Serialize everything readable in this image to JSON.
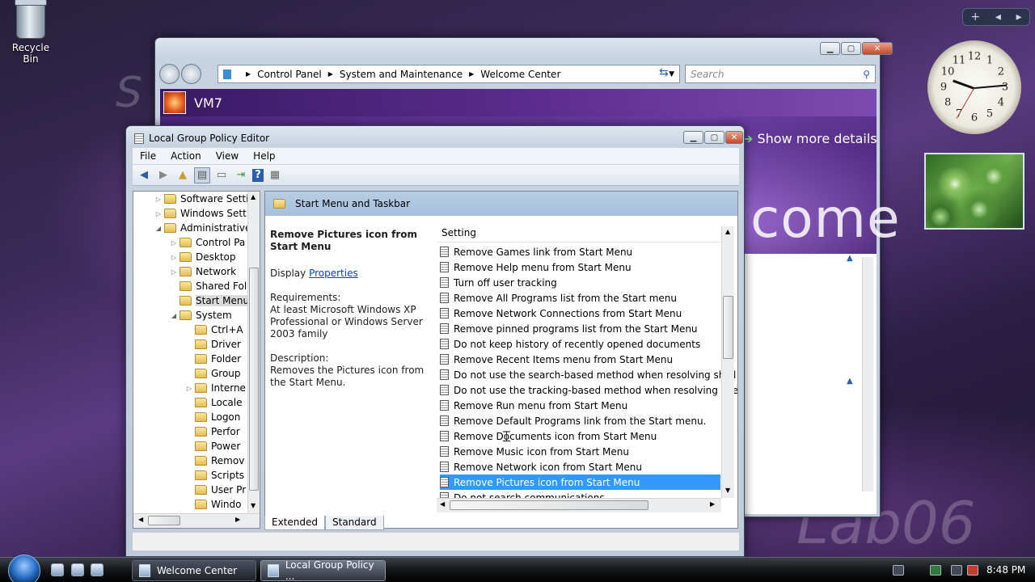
{
  "desktop": {
    "recycle_bin_label": "Recycle Bin",
    "bg_text_left": "S",
    "bg_text_right": "Lab06"
  },
  "sidebar": {
    "clock_numbers": [
      "12",
      "1",
      "2",
      "3",
      "4",
      "5",
      "6",
      "7",
      "8",
      "9",
      "10",
      "11"
    ]
  },
  "welcome_center": {
    "breadcrumb": [
      "Control Panel",
      "System and Maintenance",
      "Welcome Center"
    ],
    "search_placeholder": "Search",
    "computer_name": "VM7",
    "show_more_details": "Show more details",
    "welcome_text": "come"
  },
  "gpe": {
    "title": "Local Group Policy Editor",
    "menu": [
      "File",
      "Action",
      "View",
      "Help"
    ],
    "tree": [
      {
        "label": "Software Setti",
        "indent": 1,
        "toggle": "▷"
      },
      {
        "label": "Windows Sett",
        "indent": 1,
        "toggle": "▷"
      },
      {
        "label": "Administrative",
        "indent": 1,
        "toggle": "◢"
      },
      {
        "label": "Control Pa",
        "indent": 2,
        "toggle": "▷"
      },
      {
        "label": "Desktop",
        "indent": 2,
        "toggle": "▷"
      },
      {
        "label": "Network",
        "indent": 2,
        "toggle": "▷"
      },
      {
        "label": "Shared Fol",
        "indent": 2,
        "toggle": ""
      },
      {
        "label": "Start Menu",
        "indent": 2,
        "toggle": "",
        "selected": true
      },
      {
        "label": "System",
        "indent": 2,
        "toggle": "◢"
      },
      {
        "label": "Ctrl+A",
        "indent": 3,
        "toggle": ""
      },
      {
        "label": "Driver",
        "indent": 3,
        "toggle": ""
      },
      {
        "label": "Folder",
        "indent": 3,
        "toggle": ""
      },
      {
        "label": "Group",
        "indent": 3,
        "toggle": ""
      },
      {
        "label": "Interne",
        "indent": 3,
        "toggle": "▷"
      },
      {
        "label": "Locale",
        "indent": 3,
        "toggle": ""
      },
      {
        "label": "Logon",
        "indent": 3,
        "toggle": ""
      },
      {
        "label": "Perfor",
        "indent": 3,
        "toggle": ""
      },
      {
        "label": "Power",
        "indent": 3,
        "toggle": ""
      },
      {
        "label": "Remov",
        "indent": 3,
        "toggle": ""
      },
      {
        "label": "Scripts",
        "indent": 3,
        "toggle": ""
      },
      {
        "label": "User Pr",
        "indent": 3,
        "toggle": ""
      },
      {
        "label": "Windo",
        "indent": 3,
        "toggle": ""
      }
    ],
    "folder_header": "Start Menu and Taskbar",
    "detail": {
      "title": "Remove Pictures icon from Start Menu",
      "display_prefix": "Display",
      "display_link": "Properties",
      "requirements_label": "Requirements:",
      "requirements": "At least Microsoft Windows XP Professional or Windows Server 2003 family",
      "description_label": "Description:",
      "description": "Removes the Pictures icon from the Start Menu."
    },
    "list_header": "Setting",
    "settings": [
      "Remove Games link from Start Menu",
      "Remove Help menu from Start Menu",
      "Turn off user tracking",
      "Remove All Programs list from the Start menu",
      "Remove Network Connections from Start Menu",
      "Remove pinned programs list from the Start Menu",
      "Do not keep history of recently opened documents",
      "Remove Recent Items menu from Start Menu",
      "Do not use the search-based method when resolving shell s...",
      "Do not use the tracking-based method when resolving shell ...",
      "Remove Run menu from Start Menu",
      "Remove Default Programs link from the Start menu.",
      "Remove Documents icon from Start Menu",
      "Remove Music icon from Start Menu",
      "Remove Network icon from Start Menu",
      "Remove Pictures icon from Start Menu",
      "Do not search communications"
    ],
    "selected_setting_index": 15,
    "tabs": [
      "Extended",
      "Standard"
    ]
  },
  "taskbar": {
    "buttons": [
      "Welcome Center",
      "Local Group Policy ..."
    ],
    "active_button_index": 1,
    "time": "8:48 PM"
  }
}
